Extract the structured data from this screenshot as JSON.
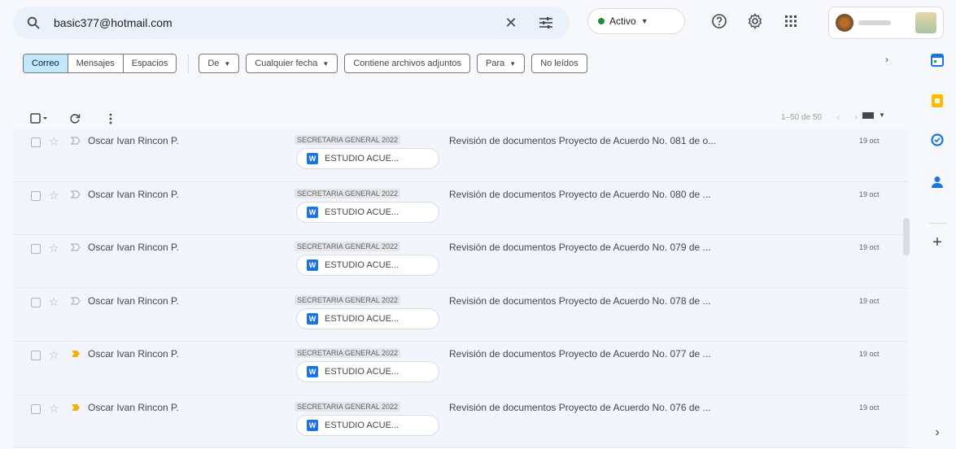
{
  "search": {
    "value": "basic377@hotmail.com",
    "clear_label": "✕",
    "search_icon": "search-icon",
    "tune_icon": "tune-icon"
  },
  "status": {
    "label": "Activo",
    "color": "#1e8e3e"
  },
  "topbar": {
    "help_icon": "help-icon",
    "settings_icon": "gear-icon",
    "apps_icon": "apps-grid-icon"
  },
  "filters": {
    "segments": [
      "Correo",
      "Mensajes",
      "Espacios"
    ],
    "active_segment": "Correo",
    "chips": {
      "from": "De",
      "date": "Cualquier fecha",
      "attachments": "Contiene archivos adjuntos",
      "to": "Para",
      "unread": "No leídos"
    },
    "more": "›"
  },
  "toolbar": {
    "pager": "1–50 de 50"
  },
  "emails": [
    {
      "sender": "Oscar Ivan Rincon P.",
      "label": "SECRETARIA GENERAL 2022",
      "subject": "Revisión de documentos Proyecto de Acuerdo No. 081 de o...",
      "date": "19 oct",
      "attachment": "ESTUDIO ACUE...",
      "important": false
    },
    {
      "sender": "Oscar Ivan Rincon P.",
      "label": "SECRETARIA GENERAL 2022",
      "subject": "Revisión de documentos Proyecto de Acuerdo No. 080 de ...",
      "date": "19 oct",
      "attachment": "ESTUDIO ACUE...",
      "important": false
    },
    {
      "sender": "Oscar Ivan Rincon P.",
      "label": "SECRETARIA GENERAL 2022",
      "subject": "Revisión de documentos Proyecto de Acuerdo No. 079 de ...",
      "date": "19 oct",
      "attachment": "ESTUDIO ACUE...",
      "important": false
    },
    {
      "sender": "Oscar Ivan Rincon P.",
      "label": "SECRETARIA GENERAL 2022",
      "subject": "Revisión de documentos Proyecto de Acuerdo No. 078 de ...",
      "date": "19 oct",
      "attachment": "ESTUDIO ACUE...",
      "important": false
    },
    {
      "sender": "Oscar Ivan Rincon P.",
      "label": "SECRETARIA GENERAL 2022",
      "subject": "Revisión de documentos Proyecto de Acuerdo No. 077 de ...",
      "date": "19 oct",
      "attachment": "ESTUDIO ACUE...",
      "important": true
    },
    {
      "sender": "Oscar Ivan Rincon P.",
      "label": "SECRETARIA GENERAL 2022",
      "subject": "Revisión de documentos Proyecto de Acuerdo No. 076 de ...",
      "date": "19 oct",
      "attachment": "ESTUDIO ACUE...",
      "important": true
    }
  ],
  "attachment_icon_letter": "W",
  "colors": {
    "accent": "#c2e7ff",
    "important": "#f4b400",
    "calendar": "#1a73e8",
    "keep": "#fbbc04",
    "tasks": "#1a73e8",
    "contacts": "#1a73e8"
  },
  "rail": {
    "items": [
      "calendar-icon",
      "keep-icon",
      "tasks-icon",
      "contacts-icon"
    ],
    "add": "+",
    "expand": "›"
  }
}
